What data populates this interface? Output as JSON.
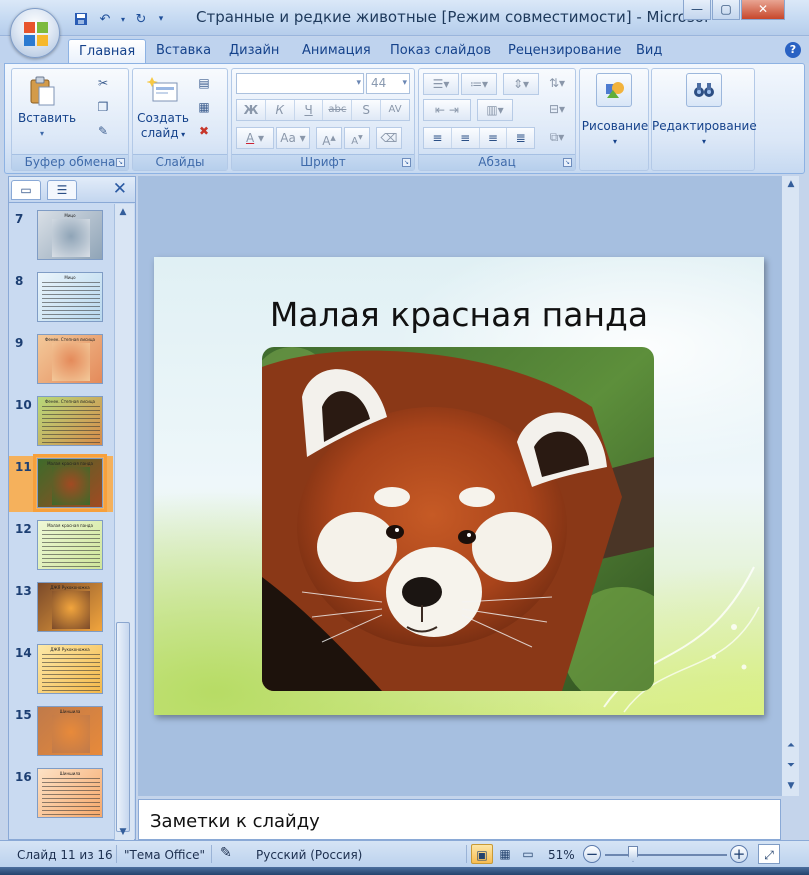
{
  "window": {
    "title": "Странные и редкие животные [Режим совместимости] - Microsof",
    "controls": [
      "—",
      "▢",
      "✕"
    ]
  },
  "quick_access": [
    "save-icon",
    "undo-icon",
    "redo-icon",
    "customize-icon"
  ],
  "ribbon": {
    "tabs": [
      "Главная",
      "Вставка",
      "Дизайн",
      "Анимация",
      "Показ слайдов",
      "Рецензирование",
      "Вид"
    ],
    "active_tab": "Главная",
    "groups": {
      "clipboard": {
        "label": "Буфер обмена",
        "paste": "Вставить"
      },
      "slides": {
        "label": "Слайды",
        "new_slide_line1": "Создать",
        "new_slide_line2": "слайд"
      },
      "font": {
        "label": "Шрифт",
        "font_name": "",
        "font_size": "44",
        "bold": "Ж",
        "italic": "К",
        "underline": "Ч",
        "strike": "abc",
        "shadow": "S",
        "spacing": "AV",
        "case": "Aa",
        "grow": "A",
        "shrink": "A"
      },
      "paragraph": {
        "label": "Абзац"
      },
      "drawing": {
        "label": "Рисование"
      },
      "editing": {
        "label": "Редактирование"
      }
    }
  },
  "slides_panel": {
    "thumbnails": [
      {
        "num": "7",
        "title": "Мицо",
        "kind": "photo",
        "colors": [
          "#8fa4b7",
          "#d9dfe6"
        ]
      },
      {
        "num": "8",
        "title": "Мицо",
        "kind": "text",
        "colors": [
          "#b8d8ee",
          "#eaf4fb"
        ]
      },
      {
        "num": "9",
        "title": "Фенек. Степная лисица",
        "kind": "photo",
        "colors": [
          "#e48a5a",
          "#f3c99a"
        ]
      },
      {
        "num": "10",
        "title": "Фенек. Степная лисица",
        "kind": "text",
        "colors": [
          "#d78b4a",
          "#b7d97a"
        ]
      },
      {
        "num": "11",
        "title": "Малая красная панда",
        "kind": "photo",
        "colors": [
          "#a24a22",
          "#3d6a2a"
        ]
      },
      {
        "num": "12",
        "title": "Малая красная панда",
        "kind": "text",
        "colors": [
          "#cfe69a",
          "#eef8d6"
        ]
      },
      {
        "num": "13",
        "title": "ДЖЯ Рукоконожка",
        "kind": "photo",
        "colors": [
          "#f2a53d",
          "#7b4a2a"
        ]
      },
      {
        "num": "14",
        "title": "ДЖЯ Рукоконожка",
        "kind": "text",
        "colors": [
          "#f4b84a",
          "#fde9a8"
        ]
      },
      {
        "num": "15",
        "title": "Шиншила",
        "kind": "photo",
        "colors": [
          "#e88a3a",
          "#c07a4a"
        ]
      },
      {
        "num": "16",
        "title": "Шиншила",
        "kind": "text",
        "colors": [
          "#f6a86a",
          "#fde2c6"
        ]
      }
    ],
    "selected": "11"
  },
  "slide": {
    "title": "Малая красная панда"
  },
  "notes": {
    "placeholder": "Заметки к слайду"
  },
  "status": {
    "slide_info": "Слайд 11 из 16",
    "theme": "\"Тема Office\"",
    "language": "Русский (Россия)",
    "zoom": "51%"
  }
}
